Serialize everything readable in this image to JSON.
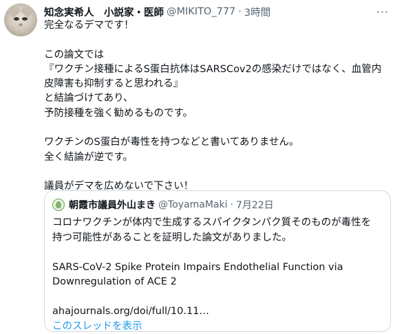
{
  "tweet": {
    "author_name": "知念実希人　小説家・医師",
    "handle": "@MIKITO_777",
    "separator": "·",
    "time": "3時間",
    "more_icon": "more-horizontal-icon",
    "lines": [
      "完全なるデマです！",
      "",
      "この論文では",
      "『ワクチン接種によるS蛋白抗体はSARSCov2の感染だけではなく、血管内",
      "皮障害も抑制すると思われる』",
      "と結論づけてあり、",
      "予防接種を強く勧めるものです。",
      "",
      "ワクチンのS蛋白が毒性を持つなどと書いてありません。",
      "全く結論が逆です。",
      "",
      "議員がデマを広めないで下さい！"
    ]
  },
  "quote": {
    "author_name": "朝霞市議員外山まき",
    "handle": "@ToyamaMaki",
    "separator": "·",
    "date": "7月22日",
    "lines": [
      "コロナワクチンが体内で生成するスパイクタンパク質そのものが毒性を",
      "持つ可能性があることを証明した論文がありました。",
      "",
      "SARS-CoV-2 Spike Protein Impairs Endothelial Function via",
      "Downregulation of ACE 2",
      "",
      "ahajournals.org/doi/full/10.11…"
    ],
    "thread_link": "このスレッドを表示"
  },
  "colors": {
    "text": "#0f1419",
    "secondary": "#536471",
    "link": "#1d9bf0",
    "border": "#cfd9de"
  }
}
